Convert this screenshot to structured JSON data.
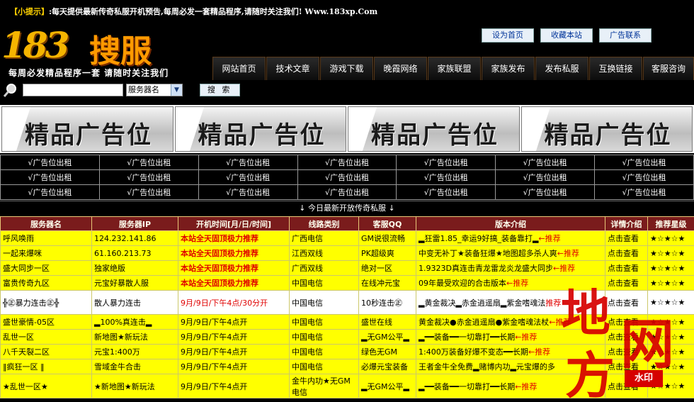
{
  "tip": {
    "tag": "【小提示】",
    "text": ":每天提供最新传奇私服开机预告,每周必发一套精品程序,请随时关注我们! Www.183xp.Com"
  },
  "logo": {
    "num": "183",
    "cn": "搜服",
    "slogan": "每周必发精品程序一套   请随时关注我们"
  },
  "header_links": [
    "设为首页",
    "收藏本站",
    "广告联系"
  ],
  "nav": [
    "网站首页",
    "技术文章",
    "游戏下载",
    "晚霞网络",
    "家族联盟",
    "家族发布",
    "发布私服",
    "互换链接",
    "客服咨询"
  ],
  "search": {
    "value": "",
    "select": "服务器名",
    "button": "搜 索"
  },
  "banners": [
    "精品广告位",
    "精品广告位",
    "精品广告位",
    "精品广告位"
  ],
  "rent_label": "√广告位出租",
  "new_today": "↓ 今日最新开放传奇私服 ↓",
  "table": {
    "headers": [
      "服务器名",
      "服务器IP",
      "开机时间[月/日/时间]",
      "线路类别",
      "客服QQ",
      "版本介绍",
      "详情介绍",
      "推荐星级"
    ],
    "rows": [
      {
        "name": "呼风唤雨",
        "ip": "124.232.141.86",
        "time": "本站全天固顶极力推荐",
        "line": "广西电信",
        "qq": "GM说很流畅",
        "ver": "▂狂雷1.85_幸运9好搞_装备靠打▂",
        "rec": "←推荐",
        "detail": "点击查看",
        "stars": "★☆★☆★"
      },
      {
        "name": "一起来爆咪",
        "ip": "61.160.213.73",
        "time": "本站全天固顶极力推荐",
        "line": "江西双线",
        "qq": "PK超级爽",
        "ver": "中变无补丁★装备狂爆★地图超多杀人爽",
        "rec": "←推荐",
        "detail": "点击查看",
        "stars": "★☆★☆★"
      },
      {
        "name": "盛大同步一区",
        "ip": "独家绝版",
        "time": "本站全天固顶极力推荐",
        "line": "广西双线",
        "qq": "绝对一区",
        "ver": "1.9323D真连击青龙雷龙炎龙盛大同步",
        "rec": "←推荐",
        "detail": "点击查看",
        "stars": "★☆★☆★"
      },
      {
        "name": "富贵传奇九区",
        "ip": "元宝好暴散人服",
        "time": "本站全天固顶极力推荐",
        "line": "中国电信",
        "qq": "在线冲元宝",
        "ver": "09年最受欢迎的合击版本",
        "rec": "←推荐",
        "detail": "点击查看",
        "stars": "★☆★☆★"
      },
      {
        "name": "╬㊣暴力连击㊣╬",
        "ip": "散人暴力连击",
        "time": "9月/9日/下午4点/30分开",
        "line": "中国电信",
        "qq": "10秒连击㊣",
        "ver": "▂黄金裁决▂赤金逍遥扇▂紫金嗜魂法",
        "rec": "推荐",
        "detail": "点击查看",
        "stars": "★☆★☆★"
      },
      {
        "name": "盛世豪情-05区",
        "ip": "▂100%真连击▂",
        "time": "9月/9日/下午4点开",
        "line": "中国电信",
        "qq": "盛世在线",
        "ver": "黄金裁决●赤金逍遥扇●紫金嗜魂法杖",
        "rec": "←推荐",
        "detail": "点击查看",
        "stars": "★☆★☆★"
      },
      {
        "name": "乱世一区",
        "ip": "新地图★新玩法",
        "time": "9月/9日/下午4点开",
        "line": "中国电信",
        "qq": "▂无GM公平▂",
        "ver": "▂━━装备━━一切靠打━━长期",
        "rec": "←推荐",
        "detail": "点击查看",
        "stars": "★☆★☆★"
      },
      {
        "name": "八千天裂二区",
        "ip": "元宝1:400万",
        "time": "9月/9日/下午4点开",
        "line": "中国电信",
        "qq": "绿色无GM",
        "ver": "1:400万装备好爆不变态━━长期",
        "rec": "←推荐",
        "detail": "点击查看",
        "stars": "★☆★☆★"
      },
      {
        "name": "‖疯狂一区 ‖",
        "ip": "雪域金牛合击",
        "time": "9月/9日/下午4点开",
        "line": "中国电信",
        "qq": "必爆元宝装备",
        "ver": "王者金牛全免费▂赌博内功▂元宝爆的多",
        "rec": "",
        "detail": "点击查看",
        "stars": "★☆★☆★"
      },
      {
        "name": "★乱世一区★",
        "ip": "★新地图★新玩法",
        "time": "9月/9日/下午4点开",
        "line": "金牛内功★无GM电信",
        "qq": "▂无GM公平▂",
        "ver": "▂━━装备━━一切靠打━━长期",
        "rec": "←推荐",
        "detail": "点击查看",
        "stars": "★☆★☆★"
      }
    ]
  },
  "watermark": {
    "chars": [
      "地",
      "网",
      "方"
    ],
    "stamp": "水印"
  }
}
